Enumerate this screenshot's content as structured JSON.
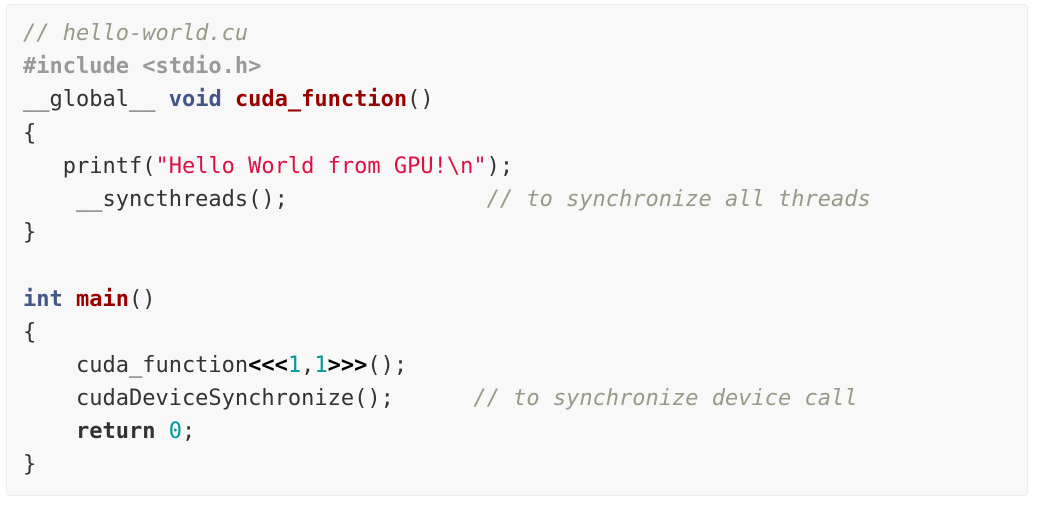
{
  "code": {
    "lines": [
      {
        "tokens": [
          {
            "t": "// hello-world.cu",
            "c": "cm"
          }
        ]
      },
      {
        "tokens": [
          {
            "t": "#include <stdio.h>",
            "c": "pp"
          }
        ]
      },
      {
        "tokens": [
          {
            "t": "__global__ ",
            "c": ""
          },
          {
            "t": "void",
            "c": "kt"
          },
          {
            "t": " ",
            "c": ""
          },
          {
            "t": "cuda_function",
            "c": "fn"
          },
          {
            "t": "()",
            "c": ""
          }
        ]
      },
      {
        "tokens": [
          {
            "t": "{",
            "c": ""
          }
        ]
      },
      {
        "tokens": [
          {
            "t": "   printf(",
            "c": ""
          },
          {
            "t": "\"Hello World from GPU!\\n\"",
            "c": "st"
          },
          {
            "t": ");",
            "c": ""
          }
        ]
      },
      {
        "tokens": [
          {
            "t": "    __syncthreads();",
            "c": ""
          },
          {
            "t": "               ",
            "c": ""
          },
          {
            "t": "// to synchronize all threads",
            "c": "cm"
          }
        ]
      },
      {
        "tokens": [
          {
            "t": "}",
            "c": ""
          }
        ]
      },
      {
        "tokens": [
          {
            "t": "",
            "c": ""
          }
        ]
      },
      {
        "tokens": [
          {
            "t": "int",
            "c": "kt"
          },
          {
            "t": " ",
            "c": ""
          },
          {
            "t": "main",
            "c": "fn"
          },
          {
            "t": "()",
            "c": ""
          }
        ]
      },
      {
        "tokens": [
          {
            "t": "{",
            "c": ""
          }
        ]
      },
      {
        "tokens": [
          {
            "t": "    cuda_function",
            "c": ""
          },
          {
            "t": "<<<",
            "c": "op"
          },
          {
            "t": "1",
            "c": "nm"
          },
          {
            "t": ",",
            "c": ""
          },
          {
            "t": "1",
            "c": "nm"
          },
          {
            "t": ">>>",
            "c": "op"
          },
          {
            "t": "();",
            "c": ""
          }
        ]
      },
      {
        "tokens": [
          {
            "t": "    cudaDeviceSynchronize();",
            "c": ""
          },
          {
            "t": "      ",
            "c": ""
          },
          {
            "t": "// to synchronize device call",
            "c": "cm"
          }
        ]
      },
      {
        "tokens": [
          {
            "t": "    ",
            "c": ""
          },
          {
            "t": "return",
            "c": "kw"
          },
          {
            "t": " ",
            "c": ""
          },
          {
            "t": "0",
            "c": "nm"
          },
          {
            "t": ";",
            "c": ""
          }
        ]
      },
      {
        "tokens": [
          {
            "t": "}",
            "c": ""
          }
        ]
      }
    ]
  }
}
